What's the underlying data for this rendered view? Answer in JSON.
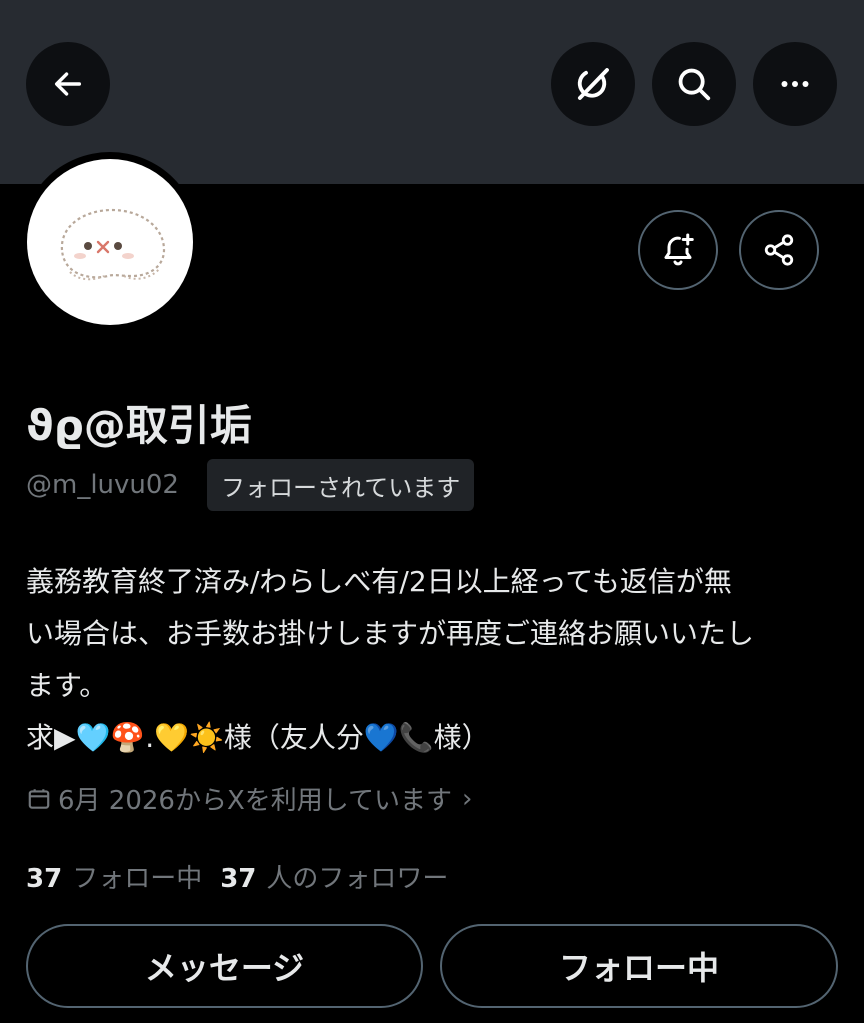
{
  "header": {
    "back_icon": "arrow-left-icon",
    "grok_icon": "grok-icon",
    "search_icon": "search-icon",
    "more_icon": "more-horizontal-icon",
    "banner_color": "#272b31"
  },
  "profile": {
    "display_name": "ϑϱ@取引垢",
    "handle": "@m_luvu02",
    "follows_you": "フォローされています",
    "bio": [
      "義務教育終了済み/わらしべ有/2日以上経っても返信が無",
      "い場合は、お手数お掛けしますが再度ご連絡お願いいたし",
      "ます。",
      "求▶🩵🍄.💛☀️様（友人分💙📞様）"
    ],
    "joined": "6月 2026からXを利用しています",
    "following_count": "37",
    "following_label": "フォロー中",
    "followers_count": "37",
    "followers_label": "人のフォロワー"
  },
  "actions": {
    "notify_icon": "bell-plus-icon",
    "share_icon": "share-icon",
    "message_label": "メッセージ",
    "following_button_label": "フォロー中"
  },
  "colors": {
    "background": "#000000",
    "text_primary": "#e7e9ea",
    "text_secondary": "#71767b",
    "border": "#536471"
  }
}
